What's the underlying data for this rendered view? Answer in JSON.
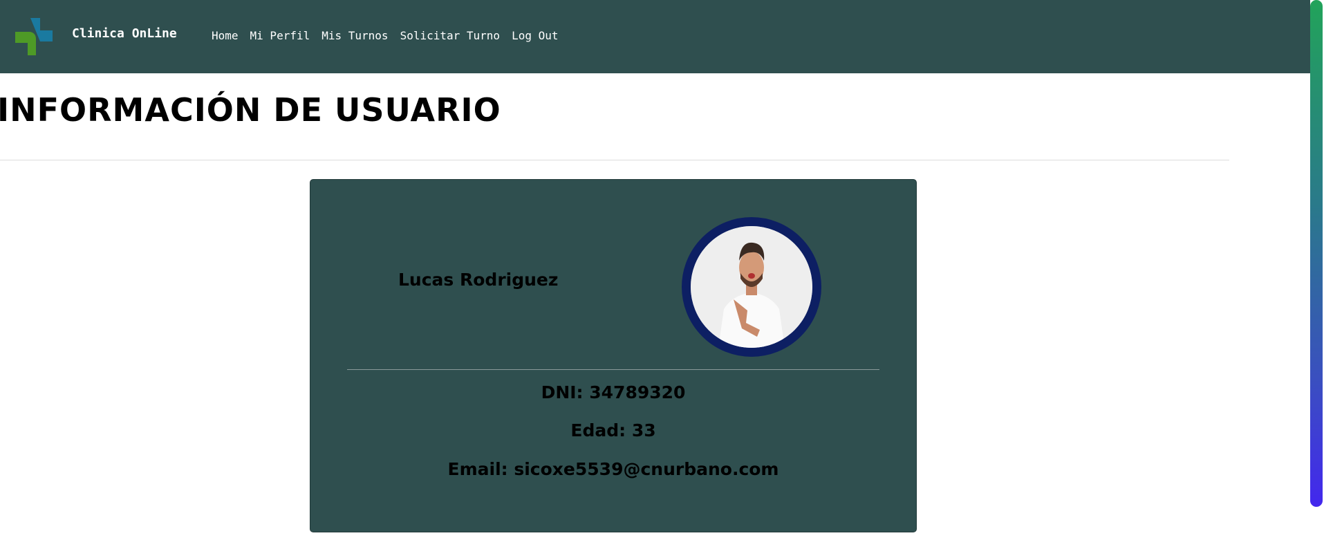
{
  "nav": {
    "brand": "Clinica OnLine",
    "links": [
      "Home",
      "Mi Perfil",
      "Mis Turnos",
      "Solicitar Turno",
      "Log Out"
    ]
  },
  "page": {
    "title": "INFORMACIÓN DE USUARIO"
  },
  "user": {
    "name": "Lucas Rodriguez",
    "dni": "DNI: 34789320",
    "edad": "Edad: 33",
    "email": "Email: sicoxe5539@cnurbano.com"
  },
  "colors": {
    "nav_bg": "#2f4f4f",
    "card_bg": "#2f4f4f",
    "avatar_ring": "#0d1f63"
  }
}
